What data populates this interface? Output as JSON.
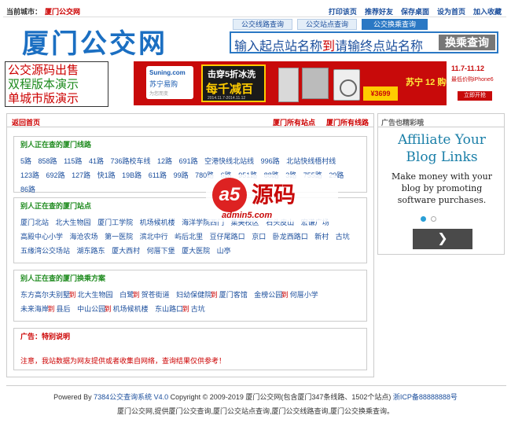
{
  "topbar": {
    "city_label": "当前城市：",
    "city_value": "厦门公交网",
    "links": [
      "打印该页",
      "推荐好友",
      "保存桌面",
      "设为首页",
      "加入收藏"
    ]
  },
  "header": {
    "logo": "厦门公交网",
    "tabs": [
      "公交线路查询",
      "公交站点查询",
      "公交换乘查询"
    ],
    "search_hint_a": "输入起点站名称",
    "search_hint_to": "到",
    "search_hint_b": "请输终点站名称",
    "search_button": "换乘查询"
  },
  "left_ad": {
    "line1": "公交源码出售",
    "line2": "双程版本演示",
    "line3": "单城市版演示"
  },
  "banner": {
    "suning_en": "Suning.com",
    "suning_cn": "苏宁易购",
    "suning_sub": "为您而变",
    "promo_a": "击穿5折冰洗",
    "promo_b": "每千减百",
    "promo_date": "2014.11.7-2014.11.12",
    "price": "¥3699",
    "suning2": "苏宁 12 购物节",
    "date": "11.7-11.12",
    "phone": "最低价购iPhone6",
    "buy": "立即开抢"
  },
  "main": {
    "back": "返回首页",
    "all_stations": "厦门所有站点",
    "all_lines": "厦门所有线路",
    "lines_title": "别人正在查的厦门线路",
    "lines": [
      "5路",
      "858路",
      "115路",
      "41路",
      "736路校车线",
      "12路",
      "691路",
      "空港快线北站线",
      "996路",
      "北站快线梧村线",
      "123路",
      "692路",
      "127路",
      "快1路",
      "19B路",
      "611路",
      "99路",
      "780路",
      "6路",
      "951路",
      "88路",
      "3路",
      "755路",
      "29路",
      "86路"
    ],
    "stations_title": "别人正在查的厦门站点",
    "stations": [
      "厦门北站",
      "北大生物园",
      "厦门工学院",
      "机场候机楼",
      "海洋学院西门",
      "",
      "",
      "",
      "",
      "",
      "",
      "",
      "集美校区",
      "石头皮山",
      "宏谦广场",
      "高殿中心小学",
      "海沧农场",
      "第一医院",
      "滨北中行",
      "屿后北里",
      "豆仔尾路口",
      "京口",
      "卧龙西路口",
      "新村",
      "古坑",
      "五缘湾公交场站",
      "湖东路东",
      "厦大西村",
      "何厝下堡",
      "厦大医院",
      "山亭"
    ],
    "transfer_title": "别人正在查的厦门换乘方案",
    "transfers": [
      {
        "from": "东方高尔夫别墅",
        "to": "北大生物园"
      },
      {
        "from": "白鹭",
        "to": "贺苍街道"
      },
      {
        "from": "妇幼保健院",
        "to": "厦门客馆"
      },
      {
        "from": "金榜公园",
        "to": "何厝小学"
      },
      {
        "from": "未来海岸",
        "to": "县后"
      },
      {
        "from": "中山公园",
        "to": "机场候机楼"
      },
      {
        "from": "东山路口",
        "to": "古坑"
      }
    ],
    "notice_title": "广告：特别说明",
    "notice_text": "注意，我站数据为网友提供或者收集自网络，查询结果仅供参考！"
  },
  "watermark": {
    "mark": "a5",
    "cn": "源码",
    "domain": "admin5.com"
  },
  "right": {
    "title": "广告也精彩哦",
    "ad_heading": "Affiliate Your Blog Links",
    "ad_body": "Make money with your blog by promoting software purchases.",
    "next": "❯"
  },
  "footer": {
    "powered_prefix": "Powered By ",
    "powered_link": "7384公交查询系统 V4.0",
    "copyright": " Copyright © 2009-2019 厦门公交网(包含厦门347条线路、1502个站点) ",
    "icp": "浙ICP备88888888号",
    "line2": "厦门公交网,提供厦门公交查询,厦门公交站点查询,厦门公交线路查询,厦门公交换乘查询。"
  }
}
